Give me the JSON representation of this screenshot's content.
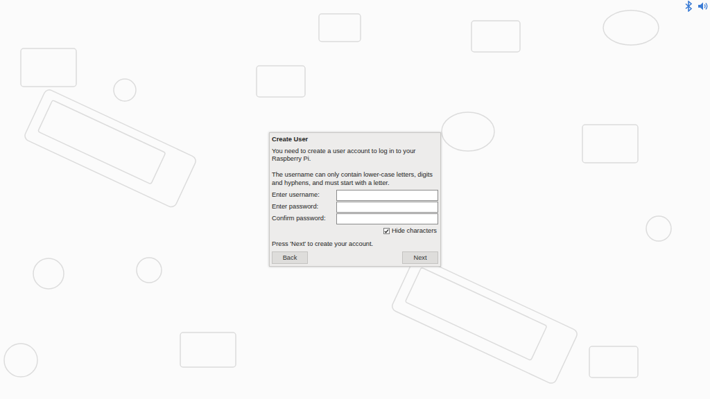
{
  "dialog": {
    "title": "Create User",
    "intro": "You need to create a user account to log in to your Raspberry Pi.",
    "rules": "The username can only contain lower-case letters, digits and hyphens, and must start with a letter.",
    "fields": [
      {
        "label": "Enter username:"
      },
      {
        "label": "Enter password:"
      },
      {
        "label": "Confirm password:"
      }
    ],
    "hide_characters": {
      "label": "Hide characters",
      "checked": true
    },
    "hint": "Press 'Next' to create your account.",
    "buttons": [
      {
        "label": "Back"
      },
      {
        "label": "Next"
      }
    ]
  }
}
